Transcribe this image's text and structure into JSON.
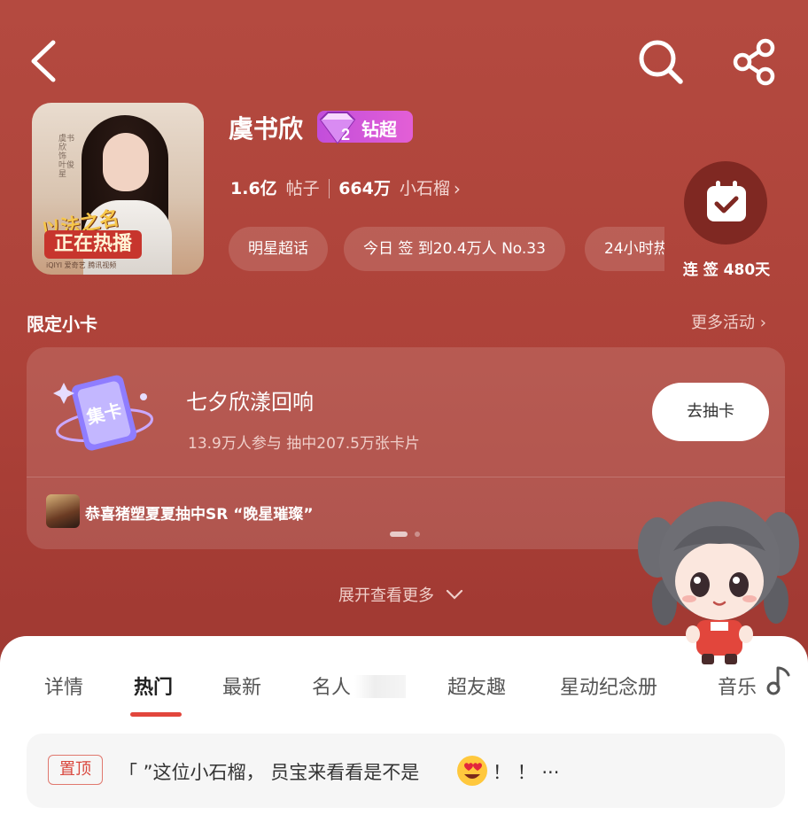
{
  "header": {
    "back_icon": "chevron-left-icon",
    "search_icon": "search-icon",
    "share_icon": "share-icon"
  },
  "profile": {
    "name": "虞书欣",
    "badge_level": "2",
    "badge_label": "钻超",
    "cover": {
      "script_title": "以法之名",
      "banner": "正在热播",
      "logos": "iQIYI 爱奇艺   腾讯视频",
      "side_text": "虞书欣 饰 叶俊星"
    },
    "posts_count": "1.6亿",
    "posts_unit": "帖子",
    "fans_count": "664万",
    "fans_unit": "小石榴",
    "pills": [
      "明星超话",
      "今日 签 到20.4万人  No.33",
      "24小时热"
    ],
    "checkin_label": "连 签 480天"
  },
  "limited_cards": {
    "title": "限定小卡",
    "more": "更多活动",
    "event_icon_text": "集卡",
    "event_title": "七夕欣漾回响",
    "event_stats": "13.9万人参与  抽中207.5万张卡片",
    "draw_button": "去抽卡",
    "winner_text": "恭喜猪塑夏夏抽中SR “晚星璀璨”",
    "expand": "展开查看更多"
  },
  "tabs": [
    {
      "label": "详情"
    },
    {
      "label": "热门"
    },
    {
      "label": "最新"
    },
    {
      "label": "名人"
    },
    {
      "label": "超友趣"
    },
    {
      "label": "星动纪念册"
    },
    {
      "label": "音乐"
    }
  ],
  "pinned_post": {
    "tag": "置顶",
    "text": "「 ”这位小石榴， 员宝来看看是不是",
    "tail": "！ ！  ···"
  },
  "colors": {
    "background": "#b3453c",
    "accent_red": "#e2463c",
    "badge_purple": "#c24edb"
  }
}
